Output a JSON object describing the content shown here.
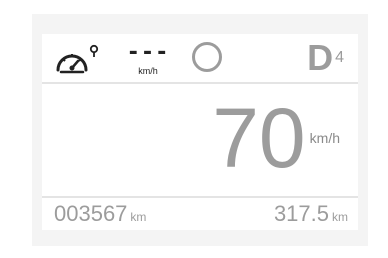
{
  "cluster": {
    "cruise_icon": "cruise-control-icon",
    "set_speed": {
      "value": "---",
      "unit": "km/h"
    },
    "status_ring_icon": "ring-indicator-icon",
    "gear": {
      "letter": "D",
      "number": "4"
    },
    "speed": {
      "value": "70",
      "unit": "km/h"
    },
    "odometer": {
      "value": "003567",
      "unit": "km"
    },
    "trip": {
      "value": "317.5",
      "unit": "km"
    }
  },
  "colors": {
    "frame_bg": "#f4f4f4",
    "panel_bg": "#ffffff",
    "dim_text": "#9c9c9c",
    "dark_text": "#222222"
  }
}
